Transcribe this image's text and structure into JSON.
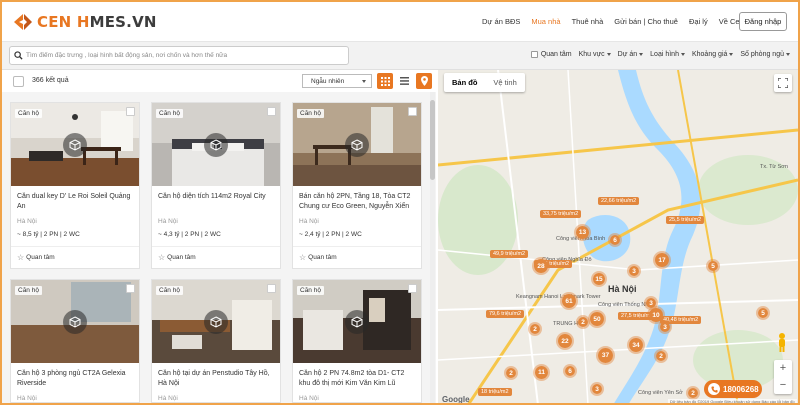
{
  "brand": {
    "logo_primary": "CEN H",
    "logo_rest": "MES.VN",
    "accent": "#e87722"
  },
  "nav": {
    "items": [
      "Dự án BĐS",
      "Mua nhà",
      "Thuê nhà",
      "Gửi bán | Cho thuê",
      "Đại lý",
      "Về CenHomes"
    ],
    "active_index": 1,
    "login": "Đăng nhập"
  },
  "search": {
    "placeholder": "Tìm điểm đặc trưng , loại hình bất động sản, nơi chốn và hơn thế nữa"
  },
  "filters": {
    "items": [
      "Quan tâm",
      "Khu vực",
      "Dự án",
      "Loại hình",
      "Khoảng giá",
      "Số phòng ngủ"
    ]
  },
  "list": {
    "result_count": "366 kết quả",
    "sort_value": "Ngẫu nhiên"
  },
  "cards": [
    {
      "badge": "Căn hộ",
      "title": "Căn dual key D' Le Roi Soleil Quảng An",
      "location": "Hà Nội",
      "meta": "~ 8,5 tỷ | 2 PN | 2 WC",
      "save": "Quan tâm"
    },
    {
      "badge": "Căn hộ",
      "title": "Căn hộ diện tích 114m2 Royal City",
      "location": "Hà Nội",
      "meta": "~ 4,3 tỷ | 2 PN | 2 WC",
      "save": "Quan tâm"
    },
    {
      "badge": "Căn hộ",
      "title": "Bán căn hộ 2PN, Tầng 18, Tòa CT2 Chung cư Eco Green, Nguyễn Xiển",
      "location": "Hà Nội",
      "meta": "~ 2,4 tỷ | 2 PN | 2 WC",
      "save": "Quan tâm"
    },
    {
      "badge": "Căn hộ",
      "title": "Căn hộ 3 phòng ngủ CT2A Gelexia Riverside",
      "location": "Hà Nội",
      "meta": "",
      "save": ""
    },
    {
      "badge": "Căn hộ",
      "title": "Căn hộ tại dự án Penstudio Tây Hồ, Hà Nội",
      "location": "Hà Nội",
      "meta": "",
      "save": ""
    },
    {
      "badge": "Căn hộ",
      "title": "Căn hộ 2 PN 74.8m2 tòa D1- CT2 khu đô thị mới Kim Văn Kim Lũ",
      "location": "Hà Nội",
      "meta": "",
      "save": ""
    }
  ],
  "map": {
    "tabs": [
      "Bản đồ",
      "Vệ tinh"
    ],
    "active_tab": 0,
    "clusters": [
      "13",
      "28",
      "17",
      "61",
      "3",
      "6",
      "15",
      "3",
      "5",
      "10",
      "2",
      "3",
      "22",
      "2",
      "37",
      "34",
      "2",
      "11",
      "2",
      "3",
      "2",
      "6",
      "5",
      "50"
    ],
    "prices": [
      "22,66 triệu/m2",
      "33,75 triệu/m2",
      "25,5 triệu/m2",
      "49,9 triệu/m2",
      "79,6 triệu/m2",
      "27,5 triệu/m2",
      "40,48 triệu/m2",
      "30,5 triệu/m2",
      "18 triệu/m2"
    ],
    "labels": [
      "Hà Nội",
      "TRUNG HÒA",
      "Công viên Hòa Bình",
      "Công viên Nghĩa Đô",
      "Keangnam Hanoi Landmark Tower",
      "Công viên Thống Nhất",
      "Tx. Từ Sơn",
      "Công viên Yên Sở"
    ],
    "hotline": "18006268",
    "google": "Google",
    "attribution": "Dữ liệu bản đồ ©2019 Google  Điều khoản sử dụng  Báo cáo lỗi bản đồ"
  }
}
